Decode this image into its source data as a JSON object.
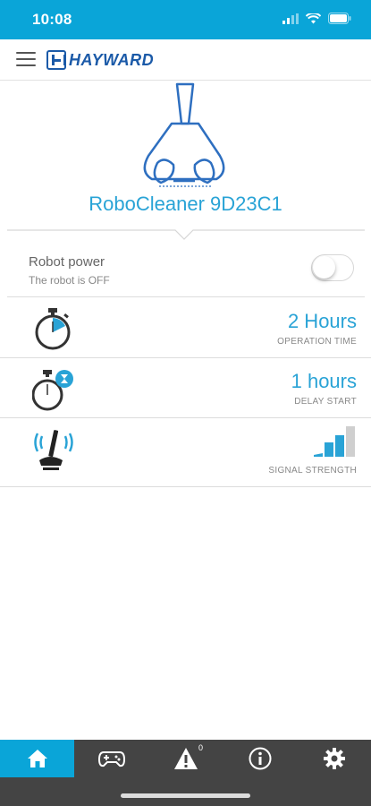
{
  "status_bar": {
    "time": "10:08"
  },
  "header": {
    "logo_text": "HAYWARD"
  },
  "robot": {
    "name": "RoboCleaner 9D23C1"
  },
  "power": {
    "title": "Robot power",
    "subtitle": "The robot is OFF",
    "on": false
  },
  "rows": [
    {
      "value": "2 Hours",
      "label": "OPERATION TIME",
      "icon": "stopwatch-icon"
    },
    {
      "value": "1 hours",
      "label": "DELAY START",
      "icon": "stopwatch-hourglass-icon"
    },
    {
      "value": "",
      "label": "SIGNAL STRENGTH",
      "icon": "robot-signal-icon",
      "signal_level": 2,
      "signal_max": 3
    }
  ],
  "bottom_nav": {
    "items": [
      "home-icon",
      "gamepad-icon",
      "alert-icon",
      "info-icon",
      "settings-icon"
    ],
    "alert_count": "0",
    "active_index": 0
  },
  "colors": {
    "accent": "#0aa5d8",
    "text_blue": "#29a3d6",
    "nav_bg": "#444444",
    "logo_blue": "#1b5aa8"
  }
}
